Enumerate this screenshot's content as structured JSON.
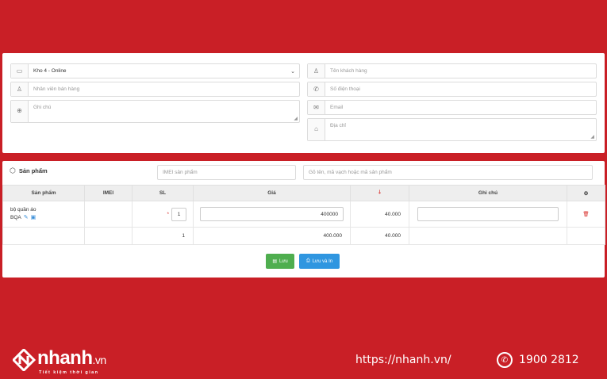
{
  "form": {
    "warehouse_value": "Kho 4 - Online",
    "staff_placeholder": "Nhân viên bán hàng",
    "note_placeholder": "Ghi chú",
    "customer_placeholder": "Tên khách hàng",
    "phone_placeholder": "Số điện thoại",
    "email_placeholder": "Email",
    "address_placeholder": "Địa chỉ"
  },
  "products": {
    "title": "Sản phẩm",
    "imei_search_placeholder": "IMEI sản phẩm",
    "product_search_placeholder": "Gõ tên, mã vạch hoặc mã sản phẩm",
    "columns": {
      "product": "Sản phẩm",
      "imei": "IMEI",
      "qty": "SL",
      "price": "Giá",
      "discount_icon": "arrow-down-icon",
      "note": "Ghi chú",
      "settings_icon": "gear-icon"
    },
    "rows": [
      {
        "name": "bộ quần áo",
        "code": "BQA",
        "qty": "1",
        "price": "400000",
        "discount": "40.000",
        "note": ""
      }
    ],
    "totals": {
      "qty": "1",
      "price": "400.000",
      "discount": "40.000"
    }
  },
  "actions": {
    "save_label": "Lưu",
    "save_print_label": "Lưu và In"
  },
  "footer": {
    "logo_text": "nhanh",
    "logo_suffix": ".vn",
    "tagline": "Tiết kiệm thời gian",
    "url": "https://nhanh.vn/",
    "phone": "1900 2812"
  },
  "colors": {
    "brand_red": "#c91f26",
    "save_green": "#4fae4f",
    "print_blue": "#2f96e0"
  }
}
